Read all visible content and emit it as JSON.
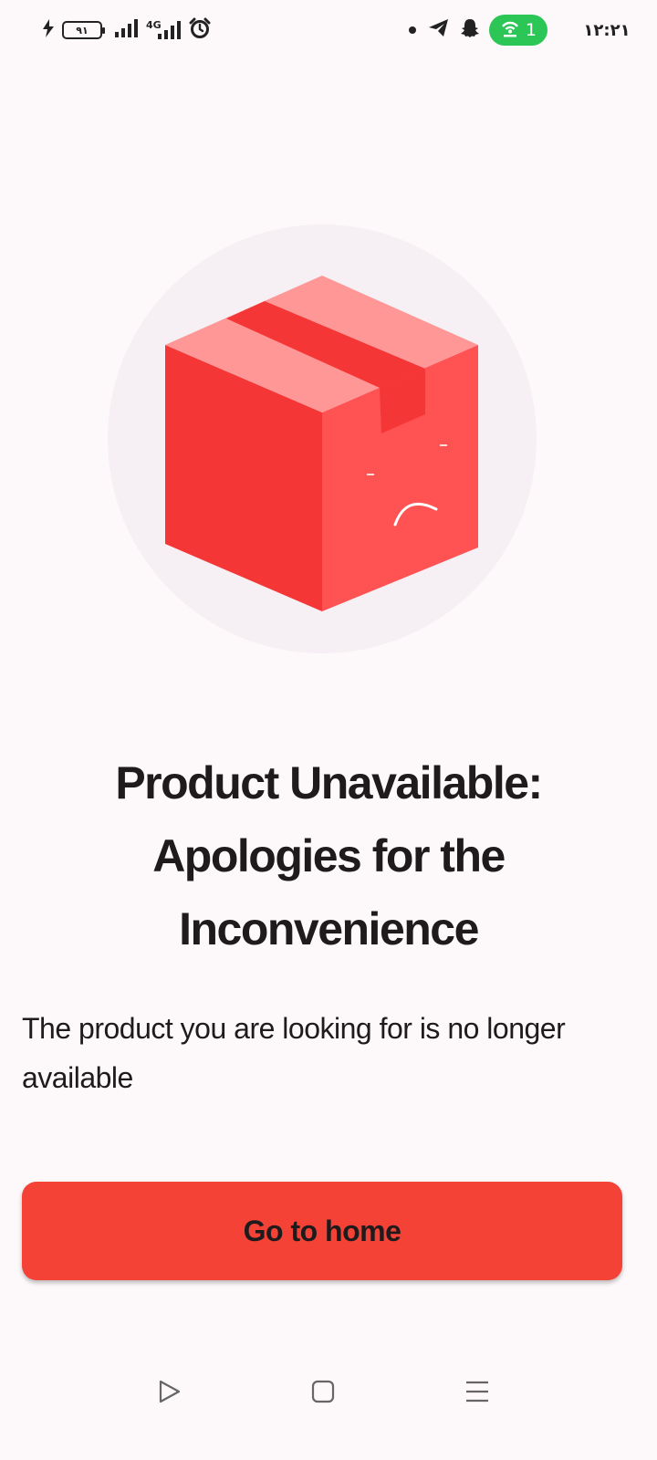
{
  "status_bar": {
    "battery_level": "۹۱",
    "network_label": "4G",
    "hotspot_count": "1",
    "time": "۱۲:۲۱",
    "icons": [
      "charging-icon",
      "battery-icon",
      "signal-icon",
      "signal-4g-icon",
      "alarm-icon",
      "notification-dot-icon",
      "telegram-icon",
      "snapchat-icon",
      "hotspot-icon"
    ]
  },
  "illustration": {
    "name": "sad-box-icon",
    "colors": {
      "circle": "#f6f0f4",
      "box_front_left": "#f43636",
      "box_front_right": "#ff5252",
      "box_top": "#ff9797",
      "tape": "#f43636"
    }
  },
  "main": {
    "title": "Product Unavailable: Apologies for the Inconvenience",
    "message": "The product you are looking for is no longer available",
    "home_button_label": "Go to home",
    "accent_color": "#f44236"
  },
  "nav_bar": {
    "buttons": [
      "back-triangle-icon",
      "home-square-icon",
      "recents-menu-icon"
    ]
  }
}
